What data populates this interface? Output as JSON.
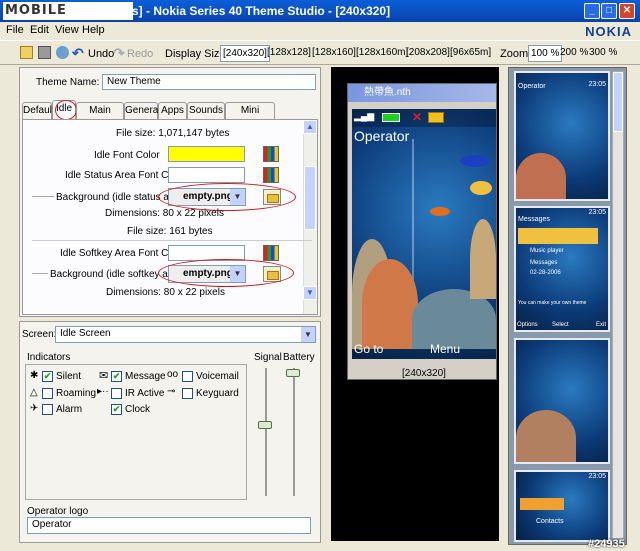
{
  "window": {
    "logo_text": "MOBILE",
    "title": "s] - Nokia Series 40 Theme Studio - [240x320]",
    "brand": "NOKIA",
    "min": "_",
    "max": "□",
    "close": "✕"
  },
  "menu": [
    "File",
    "Edit",
    "View",
    "Help"
  ],
  "toolbar": {
    "undo": "Undo",
    "redo": "Redo",
    "display_size_label": "Display Size:",
    "sizes": [
      "[240x320]",
      "[128x128]",
      "[128x160]",
      "[128x160m]",
      "[208x208]",
      "[96x65m]"
    ],
    "zoom_label": "Zoom:",
    "zooms": [
      "100 %",
      "200 %",
      "300 %"
    ]
  },
  "theme": {
    "name_label": "Theme Name:",
    "name_value": "New Theme"
  },
  "tabs": [
    "Default",
    "Idle",
    "Main Menu",
    "General",
    "Apps",
    "Sounds",
    "Mini Screen"
  ],
  "idle": {
    "file_size_1": "File size: 1,071,147 bytes",
    "font_color_label": "Idle Font Color",
    "status_font_color_label": "Idle Status Area Font Color",
    "bg_status_label": "Background (idle status area)",
    "bg_status_value": "empty.png",
    "dim_1": "Dimensions: 80 x 22 pixels",
    "file_size_2": "File size: 161 bytes",
    "softkey_font_color_label": "Idle Softkey Area Font Color",
    "bg_softkey_label": "Background (idle softkey area)",
    "bg_softkey_value": "empty.png",
    "dim_2": "Dimensions: 80 x 22 pixels"
  },
  "screen_select": {
    "label": "Screen:",
    "value": "Idle Screen"
  },
  "indicators": {
    "title": "Indicators",
    "signal_label": "Signal",
    "battery_label": "Battery",
    "items": [
      {
        "label": "Silent",
        "checked": true
      },
      {
        "label": "Message",
        "checked": true
      },
      {
        "label": "Voicemail",
        "checked": false
      },
      {
        "label": "Roaming",
        "checked": false
      },
      {
        "label": "IR Active",
        "checked": false
      },
      {
        "label": "Keyguard",
        "checked": false
      },
      {
        "label": "Alarm",
        "checked": false
      },
      {
        "label": "Clock",
        "checked": true
      }
    ]
  },
  "operator_logo": {
    "label": "Operator logo",
    "value": "Operator"
  },
  "preview": {
    "window_title": "熱帶魚.nth",
    "operator": "Operator",
    "left_softkey": "Go to",
    "right_softkey": "Menu",
    "resolution": "[240x320]"
  },
  "thumbs": {
    "t1_operator": "Operator",
    "t2_title": "Messages",
    "t2_line1": "Music player",
    "t2_line2": "Messages",
    "t2_line3": "02-28-2006",
    "t2_line4": "You can make your own theme",
    "t2_left": "Options",
    "t2_mid": "Select",
    "t2_right": "Exit",
    "t4_item": "Contacts",
    "clock": "23:05"
  },
  "watermark": "#24935"
}
